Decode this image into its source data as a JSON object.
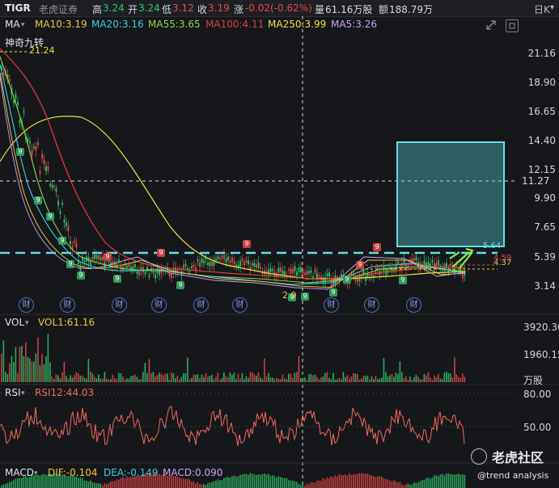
{
  "header": {
    "ticker": "TIGR",
    "broker": "老虎证券",
    "high_label": "高",
    "high_value": "3.24",
    "open_label": "开",
    "open_value": "3.24",
    "low_label": "低",
    "low_value": "3.12",
    "close_label": "收",
    "close_value": "3.19",
    "change_label": "涨",
    "change_value": "-0.02(-0.62%)",
    "volume_label": "量",
    "volume_value": "61.16万股",
    "amount_label": "额",
    "amount_value": "188.79万",
    "period": "日K"
  },
  "ma_legend": {
    "name": "MA",
    "ma10": "MA10:3.19",
    "ma20": "MA20:3.16",
    "ma55": "MA55:3.65",
    "ma100": "MA100:4.11",
    "ma250": "MA250:3.99",
    "ma5": "MA5:3.26"
  },
  "indicator": {
    "name": "神奇九转",
    "top_price": "21.24"
  },
  "price_axis": [
    "21.16",
    "18.90",
    "16.65",
    "14.40",
    "12.15",
    "9.90",
    "7.65",
    "5.39",
    "3.14"
  ],
  "cursor_price": "11.27",
  "annotations": {
    "target_level": "5.64",
    "level_2": "4.59",
    "level_3": "4.37",
    "low_mark": "2.9"
  },
  "earnings_badge": "财",
  "nine_badge": "9",
  "volume": {
    "name": "VOL",
    "vol1": "VOL1:61.16",
    "axis_top": "3920.30",
    "axis_mid": "1960.15",
    "unit": "万股"
  },
  "rsi": {
    "name": "RSI",
    "rsi12": "RSI12:44.03",
    "axis_top": "80.00",
    "axis_mid": "50.00"
  },
  "macd": {
    "name": "MACD",
    "dif": "DIF:-0.104",
    "dea": "DEA:-0.149",
    "macd": "MACD:0.090"
  },
  "watermark": {
    "brand": "老虎社区",
    "author": "@trend analysis"
  },
  "colors": {
    "ma10": "#e9c641",
    "ma20": "#39d0e0",
    "ma55": "#8fd44f",
    "ma100": "#e03c3c",
    "ma250": "#f0e03a",
    "ma5": "#c6a2f0",
    "up": "#e34a4a",
    "down": "#31c46b",
    "box": "#5fe0e8"
  }
}
